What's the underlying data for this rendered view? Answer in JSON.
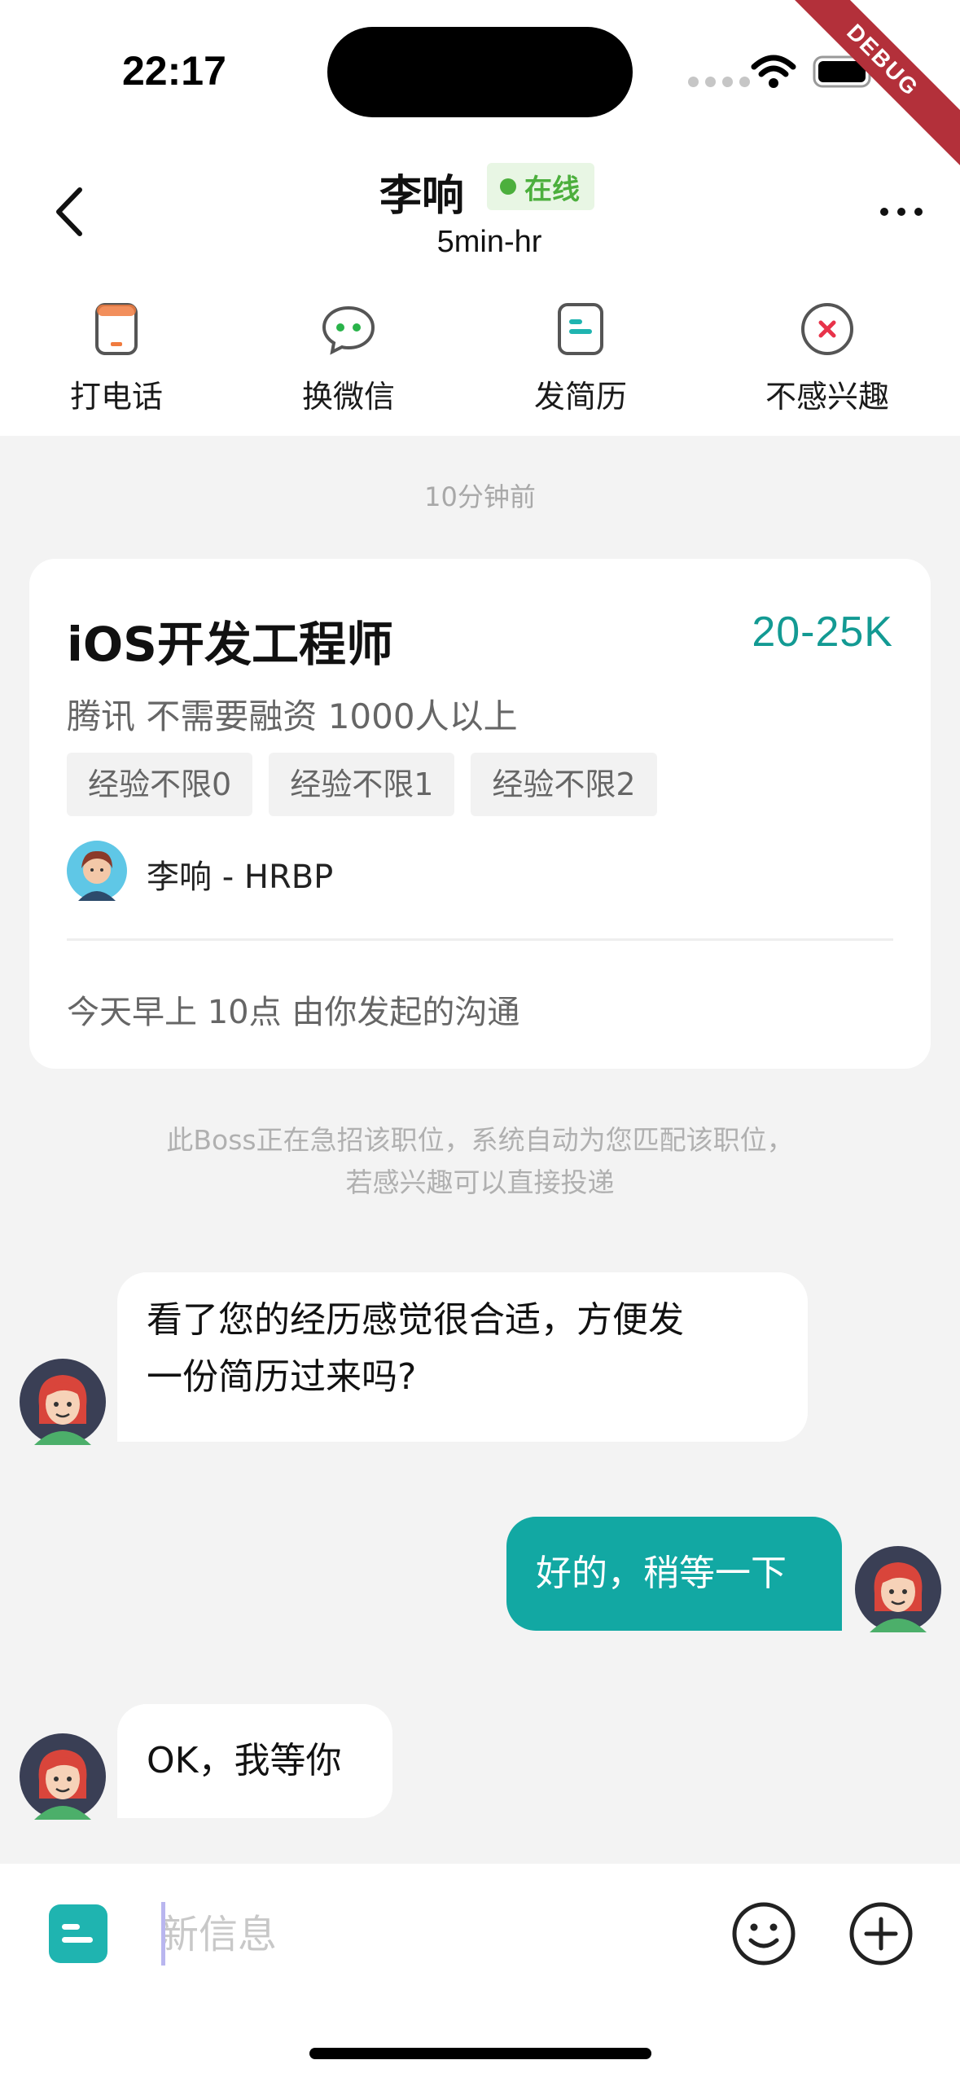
{
  "status_bar": {
    "time": "22:17",
    "debug_label": "DEBUG"
  },
  "header": {
    "name": "李响",
    "online_label": "在线",
    "subtitle": "5min-hr"
  },
  "actions": [
    {
      "label": "打电话",
      "icon": "phone-icon"
    },
    {
      "label": "换微信",
      "icon": "wechat-icon"
    },
    {
      "label": "发简历",
      "icon": "resume-icon"
    },
    {
      "label": "不感兴趣",
      "icon": "not-interested-icon"
    }
  ],
  "chat": {
    "timestamp": "10分钟前",
    "job_card": {
      "title": "iOS开发工程师",
      "salary": "20-25K",
      "company_info": "腾讯 不需要融资 1000人以上",
      "tags": [
        "经验不限0",
        "经验不限1",
        "经验不限2"
      ],
      "recruiter": "李响 - HRBP",
      "footer": "今天早上 10点 由你发起的沟通"
    },
    "notice_line1": "此Boss正在急招该职位，系统自动为您匹配该职位，",
    "notice_line2": "若感兴趣可以直接投递",
    "messages": [
      {
        "side": "left",
        "line1": "看了您的经历感觉很合适，方便发",
        "line2": "一份简历过来吗?"
      },
      {
        "side": "right",
        "text": "好的，稍等一下"
      },
      {
        "side": "left",
        "text": "OK，我等你"
      }
    ]
  },
  "input": {
    "placeholder": "新信息"
  },
  "colors": {
    "accent": "#12a8a3",
    "salary": "#139a93",
    "online": "#4caf3d",
    "phone_icon": "#f07b3f",
    "wechat_icon": "#29b34a",
    "resume_icon": "#1fb4b0",
    "dismiss_icon": "#e8334a"
  }
}
